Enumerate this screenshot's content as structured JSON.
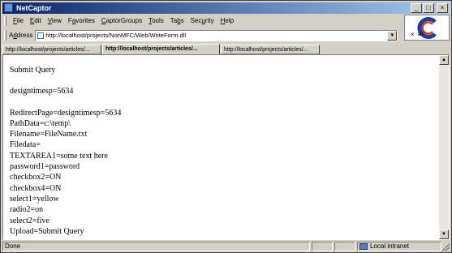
{
  "window": {
    "title": "NetCaptor"
  },
  "caption_buttons": {
    "minimize": "_",
    "maximize": "□",
    "close": "×"
  },
  "menu": {
    "items": [
      {
        "mnemonic": "F",
        "rest": "ile"
      },
      {
        "mnemonic": "E",
        "rest": "dit"
      },
      {
        "mnemonic": "V",
        "rest": "iew"
      },
      {
        "pre": "F",
        "mnemonic": "a",
        "rest": "vorites"
      },
      {
        "mnemonic": "C",
        "rest": "aptorGroups"
      },
      {
        "mnemonic": "T",
        "rest": "ools"
      },
      {
        "pre": "Ta",
        "mnemonic": "b",
        "rest": "s"
      },
      {
        "pre": "Sec",
        "mnemonic": "u",
        "rest": "rity"
      },
      {
        "mnemonic": "H",
        "rest": "elp"
      }
    ]
  },
  "address": {
    "label_pre": "A",
    "label_mnemonic": "d",
    "label_rest": "dress",
    "value": "http://localhost/projects/NonMFC/Web/WriteForm.dll",
    "extra_close": "×",
    "extra_icon": "≡!"
  },
  "tabs": [
    {
      "label": "http://localhost/projects/articles/...",
      "active": false
    },
    {
      "label": "http://localhost/projects/articles/...",
      "active": true
    },
    {
      "label": "http://localhost/projects/articles/...",
      "active": false
    }
  ],
  "content": {
    "heading": "Submit Query",
    "timestamp": "designtimesp=5634",
    "lines": [
      "RedirectPage=designtimesp=5634",
      "PathData=c:\\temp\\",
      "Filename=FileName.txt",
      "Filedata=",
      "TEXTAREA1=some text here",
      "password1=password",
      "checkbox2=ON",
      "checkbox4=ON",
      "select1=yellow",
      "radio2=on",
      "select2=five",
      "Upload=Submit Query"
    ]
  },
  "status": {
    "text": "Done",
    "zone": "Local intranet"
  },
  "colors": {
    "title_start": "#0a246a",
    "title_end": "#a6caf0",
    "chrome": "#d4d0c8"
  }
}
